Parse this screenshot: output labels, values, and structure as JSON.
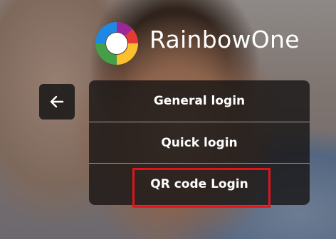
{
  "app": {
    "brand_name": "RainbowOne",
    "logo_icon": "rainbowone-logo-icon"
  },
  "navigation": {
    "back_icon": "arrow-left-icon"
  },
  "login_menu": {
    "items": [
      {
        "label": "General login"
      },
      {
        "label": "Quick login"
      },
      {
        "label": "QR code Login",
        "highlighted": true
      }
    ]
  },
  "colors": {
    "highlight_border": "#e0151b",
    "panel_background": "#181616",
    "text": "#ffffff"
  }
}
